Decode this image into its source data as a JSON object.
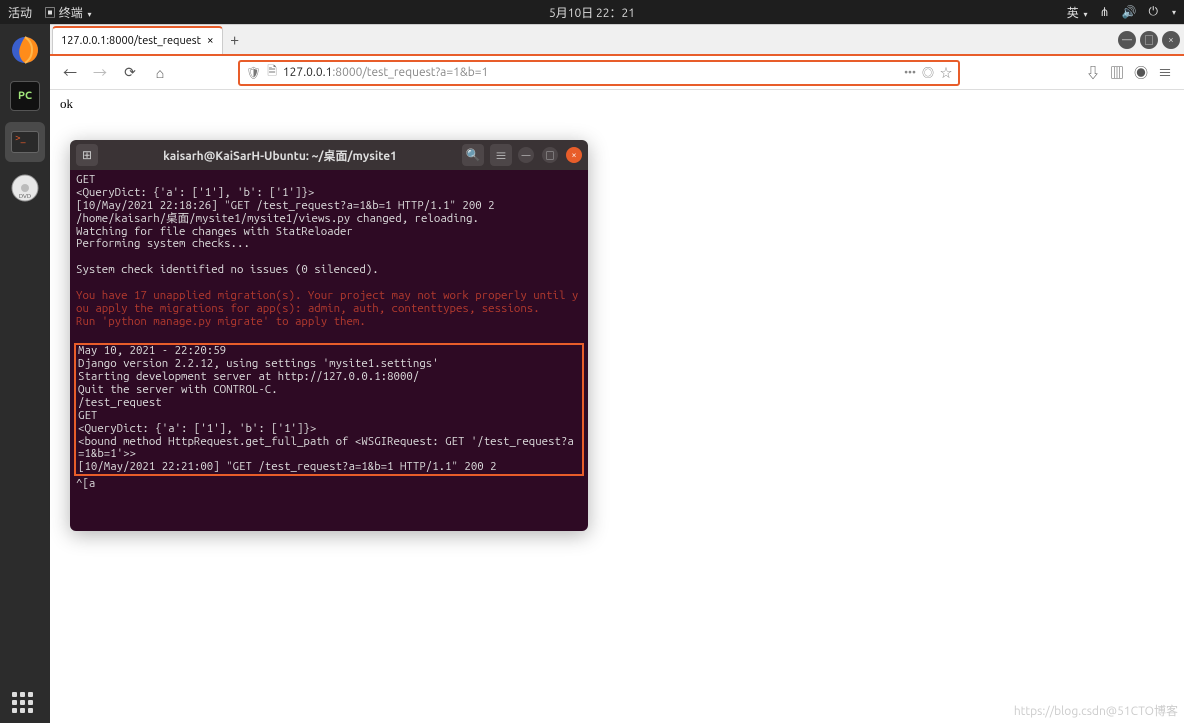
{
  "topbar": {
    "activities": "活动",
    "app_indicator": "终端",
    "datetime": "5月10日 22：21",
    "input_method": "英"
  },
  "browser": {
    "tab_title": "127.0.0.1:8000/test_request",
    "url_host": "127.0.0.1",
    "url_port_path": ":8000/test_request?a=1&b=1",
    "more_dots": "•••",
    "page_text": "ok"
  },
  "terminal": {
    "title": "kaisarh@KaiSarH-Ubuntu: ~/桌面/mysite1",
    "block1": "GET\n<QueryDict: {'a': ['1'], 'b': ['1']}>\n[10/May/2021 22:18:26] \"GET /test_request?a=1&b=1 HTTP/1.1\" 200 2\n/home/kaisarh/桌面/mysite1/mysite1/views.py changed, reloading.\nWatching for file changes with StatReloader\nPerforming system checks...\n\nSystem check identified no issues (0 silenced).",
    "warn": "You have 17 unapplied migration(s). Your project may not work properly until you apply the migrations for app(s): admin, auth, contenttypes, sessions.\nRun 'python manage.py migrate' to apply them.",
    "block2": "May 10, 2021 - 22:20:59\nDjango version 2.2.12, using settings 'mysite1.settings'\nStarting development server at http://127.0.0.1:8000/\nQuit the server with CONTROL-C.\n/test_request\nGET\n<QueryDict: {'a': ['1'], 'b': ['1']}>\n<bound method HttpRequest.get_full_path of <WSGIRequest: GET '/test_request?a=1&b=1'>>\n[10/May/2021 22:21:00] \"GET /test_request?a=1&b=1 HTTP/1.1\" 200 2",
    "tail": "^[a"
  },
  "watermark": "https://blog.csdn@51CTO博客"
}
